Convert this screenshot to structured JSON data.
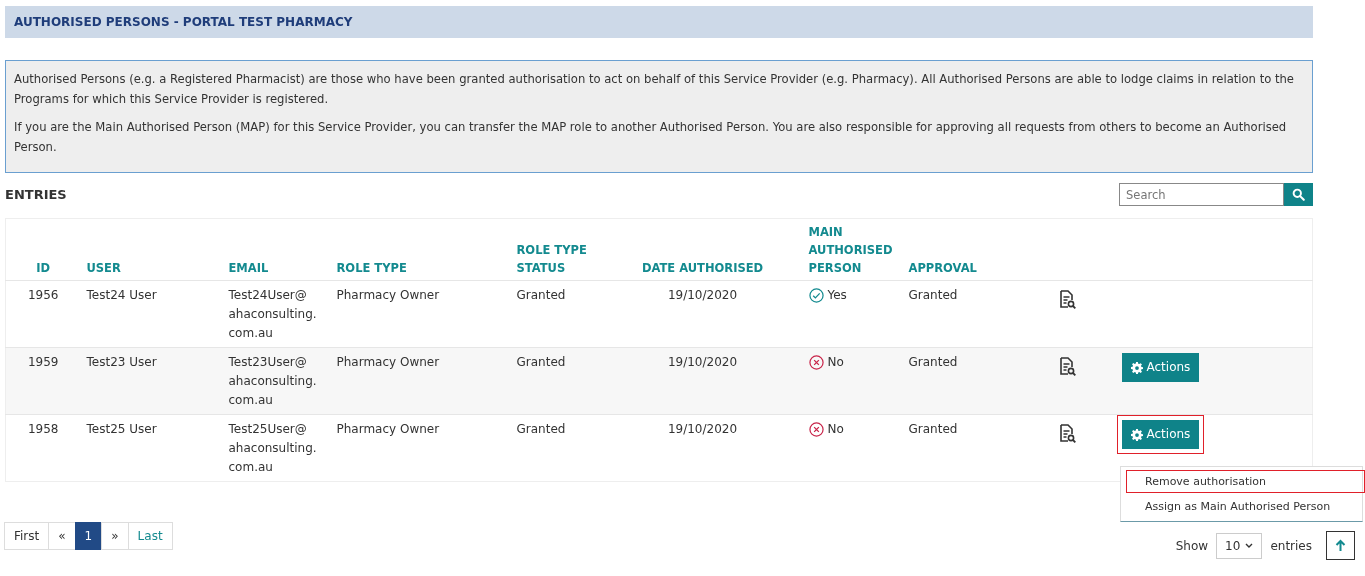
{
  "page_title": "AUTHORISED PERSONS - PORTAL TEST PHARMACY",
  "info_paragraphs": [
    "Authorised Persons (e.g. a Registered Pharmacist) are those who have been granted authorisation to act on behalf of this Service Provider (e.g. Pharmacy). All Authorised Persons are able to lodge claims in relation to the Programs for which this Service Provider is registered.",
    "If you are the Main Authorised Person (MAP) for this Service Provider, you can transfer the MAP role to another Authorised Person. You are also responsible for approving all requests from others to become an Authorised Person."
  ],
  "section_title": "ENTRIES",
  "search": {
    "placeholder": "Search"
  },
  "table": {
    "columns": [
      "ID",
      "USER",
      "EMAIL",
      "ROLE TYPE",
      "ROLE TYPE STATUS",
      "DATE AUTHORISED",
      "MAIN AUTHORISED PERSON",
      "APPROVAL"
    ],
    "rows": [
      {
        "id": "1956",
        "user": "Test24 User",
        "email": "Test24User@ahaconsulting.com.au",
        "role_type": "Pharmacy Owner",
        "status": "Granted",
        "date": "19/10/2020",
        "main": true,
        "main_label": "Yes",
        "approval": "Granted"
      },
      {
        "id": "1959",
        "user": "Test23 User",
        "email": "Test23User@ahaconsulting.com.au",
        "role_type": "Pharmacy Owner",
        "status": "Granted",
        "date": "19/10/2020",
        "main": false,
        "main_label": "No",
        "approval": "Granted",
        "actions": {
          "label": "Actions",
          "highlighted": false
        }
      },
      {
        "id": "1958",
        "user": "Test25 User",
        "email": "Test25User@ahaconsulting.com.au",
        "role_type": "Pharmacy Owner",
        "status": "Granted",
        "date": "19/10/2020",
        "main": false,
        "main_label": "No",
        "approval": "Granted",
        "actions": {
          "label": "Actions",
          "highlighted": true
        }
      }
    ]
  },
  "actions_menu": [
    {
      "label": "Remove authorisation",
      "highlighted": true
    },
    {
      "label": "Assign as Main Authorised Person",
      "highlighted": false
    }
  ],
  "pagination": [
    {
      "label": "First",
      "selected": false
    },
    {
      "label": "«",
      "selected": false
    },
    {
      "label": "1",
      "selected": true
    },
    {
      "label": "»",
      "selected": false
    },
    {
      "label": "Last",
      "selected": false
    }
  ],
  "page_size": {
    "label_before": "Show",
    "value": "10",
    "label_after": "entries"
  }
}
